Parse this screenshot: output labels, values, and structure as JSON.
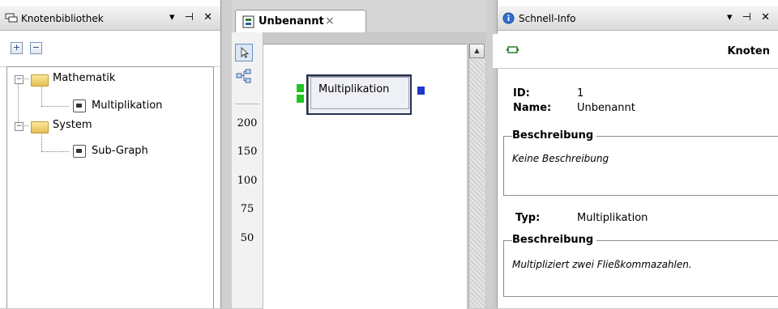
{
  "left_panel": {
    "title": "Knotenbibliothek",
    "pane_buttons": "▾ ⊣ ✕",
    "expand_all": "+",
    "collapse_all": "−",
    "tree": [
      {
        "label": "Mathematik",
        "children": [
          "Multiplikation"
        ]
      },
      {
        "label": "System",
        "children": [
          "Sub-Graph"
        ]
      }
    ]
  },
  "editor": {
    "tab_title": "Unbenannt",
    "tab_close": "×",
    "zoom_levels": [
      "200",
      "150",
      "100",
      "75",
      "50"
    ],
    "node_label": "Multiplikation"
  },
  "right_panel": {
    "title": "Schnell-Info",
    "pane_buttons": "▾ ⊣ ✕",
    "header_label": "Knoten",
    "id_label": "ID:",
    "id_value": "1",
    "name_label": "Name:",
    "name_value": "Unbenannt",
    "desc_header": "Beschreibung",
    "desc_value": "Keine Beschreibung",
    "type_label": "Typ:",
    "type_value": "Multiplikation",
    "type_desc_header": "Beschreibung",
    "type_desc_value": "Multipliziert zwei Fließkommazahlen."
  },
  "colors": {
    "port_in": "#22c322",
    "port_out": "#1f37c9",
    "node_border": "#24304f"
  }
}
